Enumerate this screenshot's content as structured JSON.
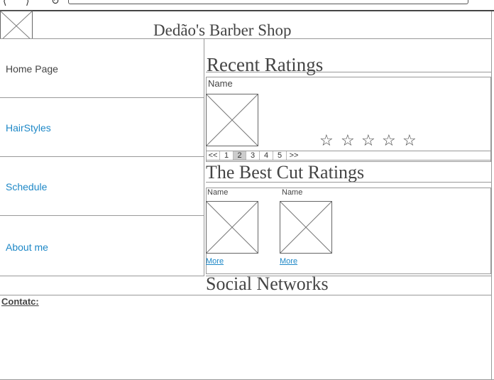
{
  "browser": {
    "back_glyph": "⟨",
    "forward_glyph": "⟩",
    "reload_glyph": "↻"
  },
  "header": {
    "title": "Dedão's Barber Shop",
    "logo_icon": "image-placeholder-icon"
  },
  "sidebar": {
    "items": [
      {
        "label": "Home Page",
        "style": "plain"
      },
      {
        "label": "HairStyles",
        "style": "link"
      },
      {
        "label": "Schedule",
        "style": "link"
      },
      {
        "label": "About me",
        "style": "link"
      }
    ]
  },
  "recent_ratings": {
    "title": "Recent Ratings",
    "name_label": "Name",
    "stars": [
      "☆",
      "☆",
      "☆",
      "☆",
      "☆"
    ],
    "rating": 0,
    "pager": {
      "items": [
        "<<",
        "1",
        "2",
        "3",
        "4",
        "5",
        ">>"
      ],
      "current": "2"
    }
  },
  "best_cut": {
    "title": "The Best Cut Ratings",
    "cards": [
      {
        "name": "Name",
        "more": "More"
      },
      {
        "name": "Name",
        "more": "More"
      }
    ]
  },
  "social": {
    "title": "Social Networks"
  },
  "footer": {
    "contact_label": "Contatc:"
  }
}
